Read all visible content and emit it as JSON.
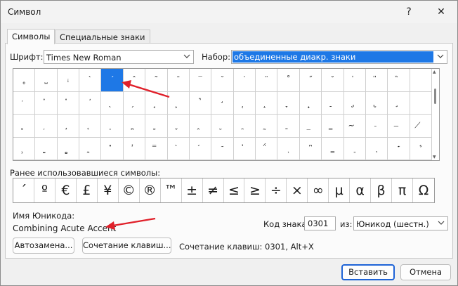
{
  "window": {
    "title": "Символ",
    "help": "?",
    "close": "✕"
  },
  "tabs": [
    {
      "label": "Символы",
      "active": true
    },
    {
      "label": "Специальные знаки",
      "active": false
    }
  ],
  "font": {
    "label": "Шрифт:",
    "value": "Times New Roman"
  },
  "subset": {
    "label": "Набор:",
    "value": "объединенные диакр. знаки"
  },
  "symbol_grid": {
    "rows": [
      [
        "˳",
        "˽",
        "ꜟ",
        "ˋ",
        "ˊ",
        "ˆ",
        "˜",
        "¯",
        "‾",
        "˘",
        "˙",
        "¨",
        "˚",
        "˝",
        "ˇ",
        "̍",
        "̎",
        "̏",
        ""
      ],
      [
        "̒",
        "̓",
        "̔",
        "̕",
        "̖",
        "̗",
        "̘",
        "̙",
        "̚",
        "̛",
        "̜",
        "̝",
        "̞",
        "̟",
        "̠",
        "̡",
        "̢",
        "̧",
        ""
      ],
      [
        "̥",
        "̦",
        "̧",
        "̨",
        "̩",
        "̪",
        "̫",
        "̬",
        "̭",
        "̮",
        "̯",
        "̰",
        "̱",
        "̲",
        "̳",
        "̴",
        "̵",
        "̶",
        "̸"
      ],
      [
        "̹",
        "̺",
        "̻",
        "̼",
        "̽",
        "̾",
        "̿",
        "̀",
        "́",
        "͂",
        "̓",
        "̈́",
        "ͅ",
        "͆",
        "͇",
        "͈",
        "͉",
        "͊",
        "͋"
      ]
    ],
    "selected": [
      0,
      4
    ]
  },
  "recent": {
    "label": "Ранее использовавшиеся символы:",
    "symbols": [
      "´",
      "º",
      "€",
      "£",
      "¥",
      "©",
      "®",
      "™",
      "±",
      "≠",
      "≤",
      "≥",
      "÷",
      "×",
      "∞",
      "µ",
      "α",
      "β",
      "π",
      "Ω"
    ]
  },
  "unicode_name": {
    "label": "Имя Юникода:",
    "value": "Combining Acute Accent"
  },
  "char_code": {
    "label": "Код знака:",
    "value": "0301",
    "from_label": "из:",
    "from_value": "Юникод (шестн.)"
  },
  "buttons": {
    "autocorrect": "Автозамена...",
    "shortcut_key": "Сочетание клавиш...",
    "shortcut_text": "Сочетание клавиш: 0301, Alt+X",
    "insert": "Вставить",
    "cancel": "Отмена"
  },
  "colors": {
    "accent": "#1e78e6",
    "annotation_arrow": "#e0202a"
  },
  "icons": {
    "dropdown": "chevron-down-icon",
    "arrow": "red-arrow-icon"
  }
}
